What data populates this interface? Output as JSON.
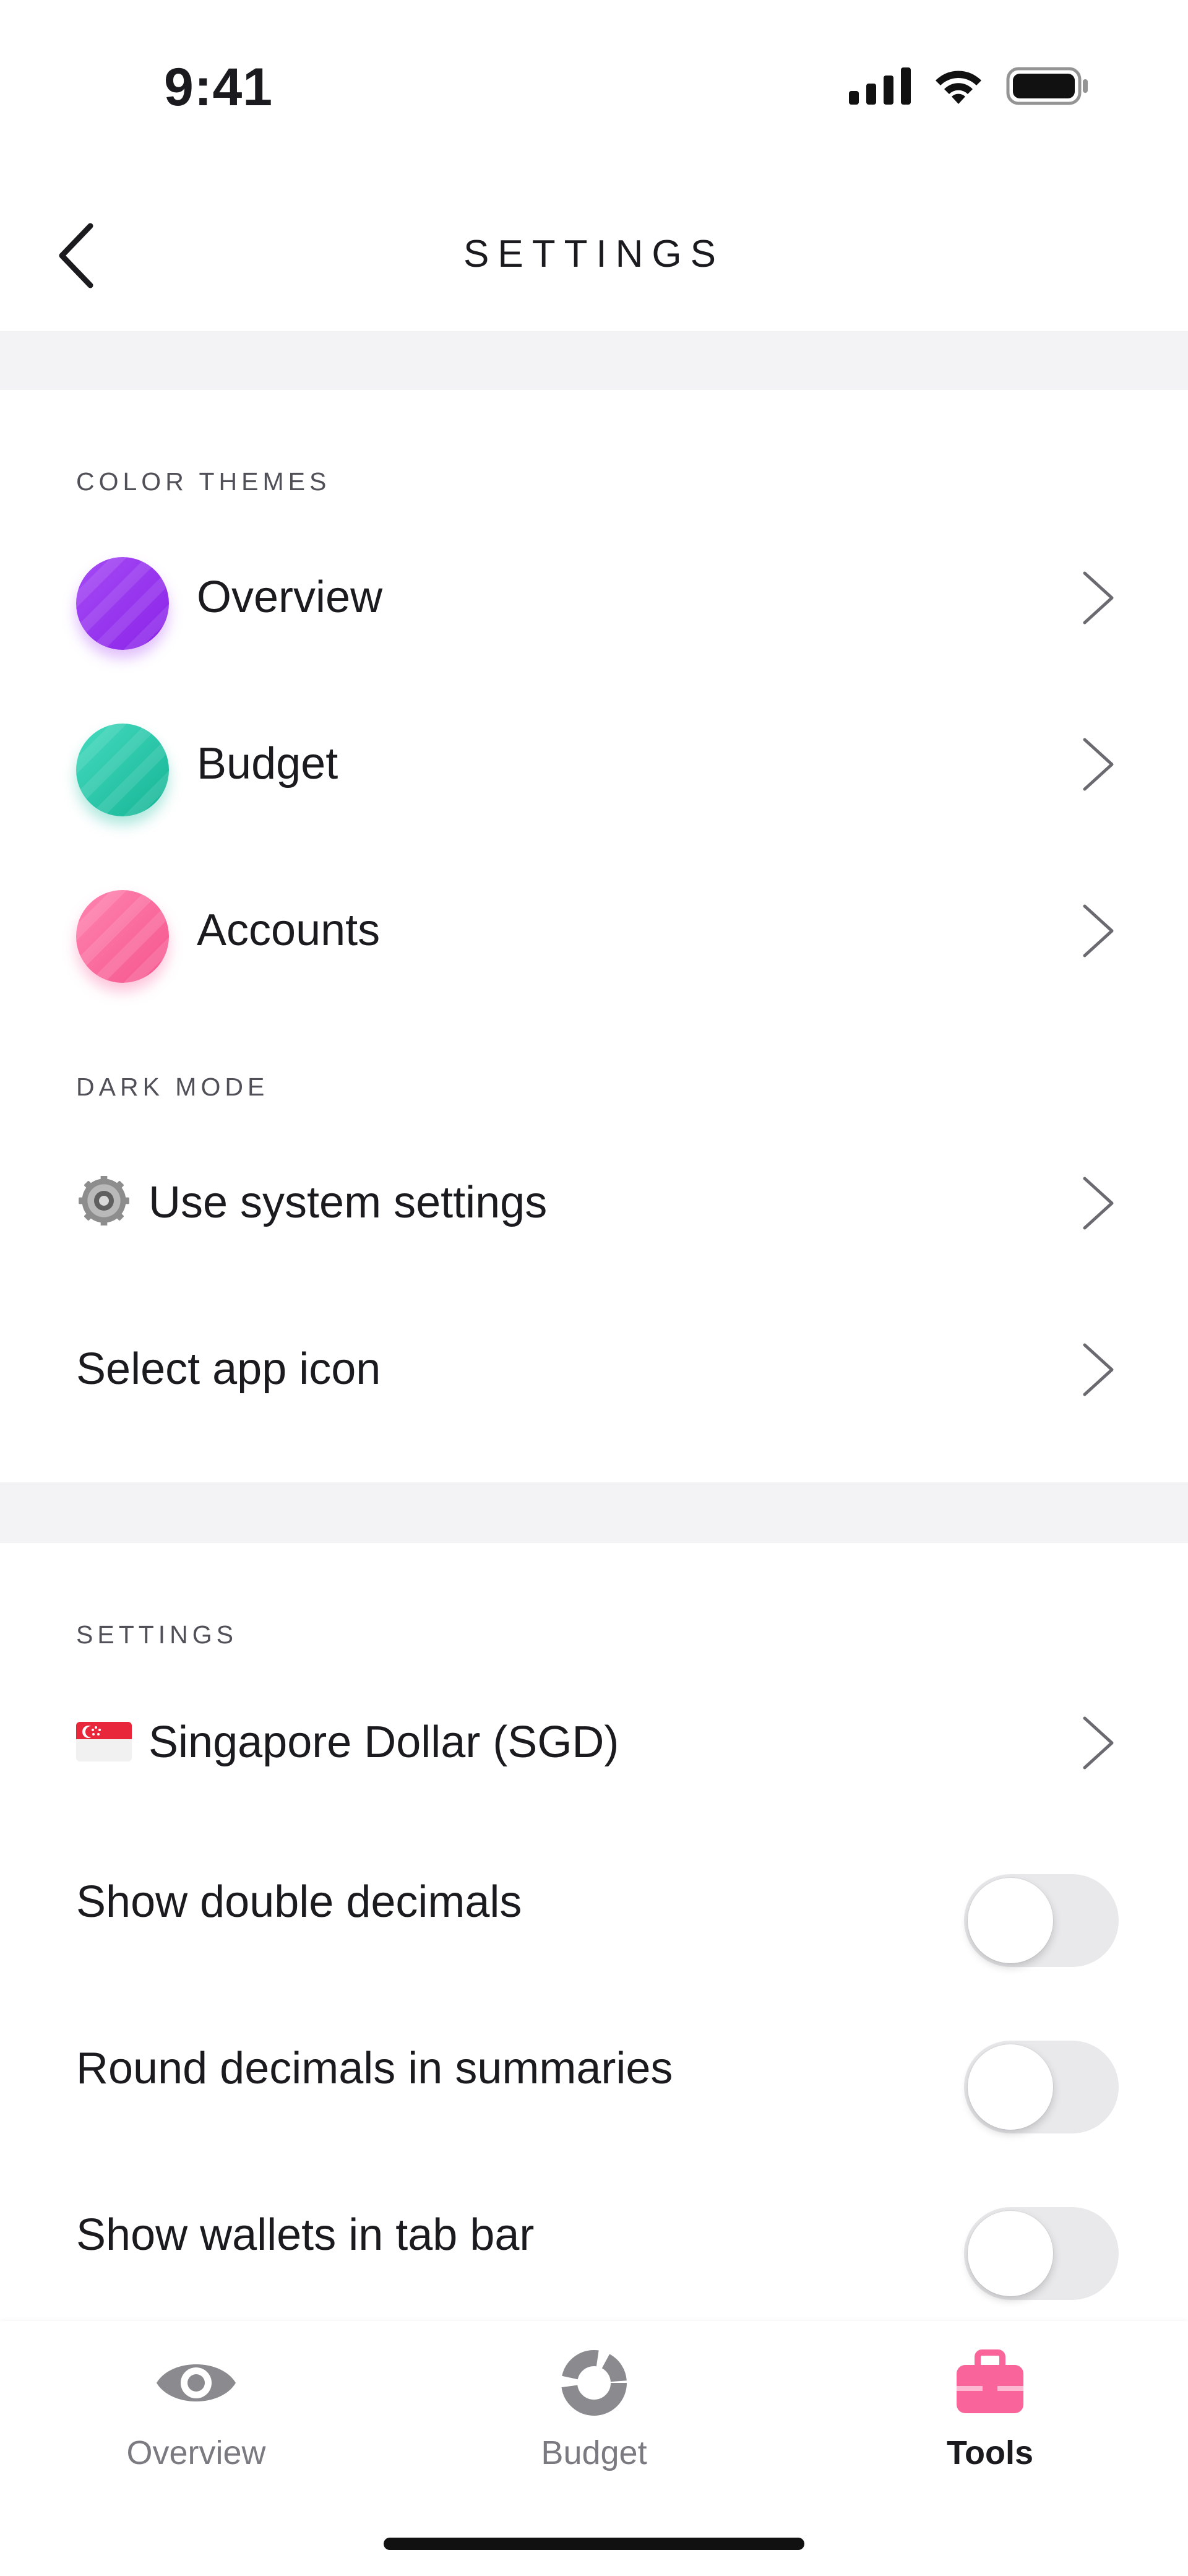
{
  "status_bar": {
    "time": "9:41",
    "icons": [
      "cellular-signal-icon",
      "wifi-icon",
      "battery-icon"
    ]
  },
  "nav": {
    "title": "SETTINGS",
    "back_icon": "chevron-left-icon"
  },
  "color_themes": {
    "header": "COLOR THEMES",
    "items": [
      {
        "label": "Overview",
        "color": "#9b35f0"
      },
      {
        "label": "Budget",
        "color": "#22c6a6"
      },
      {
        "label": "Accounts",
        "color": "#f9659a"
      }
    ]
  },
  "dark_mode": {
    "header": "DARK MODE",
    "option_label": "Use system settings",
    "option_icon": "gear-icon"
  },
  "app_icon": {
    "label": "Select app icon"
  },
  "settings": {
    "header": "SETTINGS",
    "currency": {
      "label": "Singapore Dollar (SGD)",
      "icon": "singapore-flag-icon"
    },
    "toggles": [
      {
        "label": "Show double decimals",
        "on": false
      },
      {
        "label": "Round decimals in summaries",
        "on": false
      },
      {
        "label": "Show wallets in tab bar",
        "on": false
      }
    ]
  },
  "tab_bar": {
    "tabs": [
      {
        "label": "Overview",
        "icon": "eye-icon",
        "active": false
      },
      {
        "label": "Budget",
        "icon": "donut-chart-icon",
        "active": false
      },
      {
        "label": "Tools",
        "icon": "toolbox-icon",
        "active": true
      }
    ],
    "accent": "#f9659a"
  }
}
